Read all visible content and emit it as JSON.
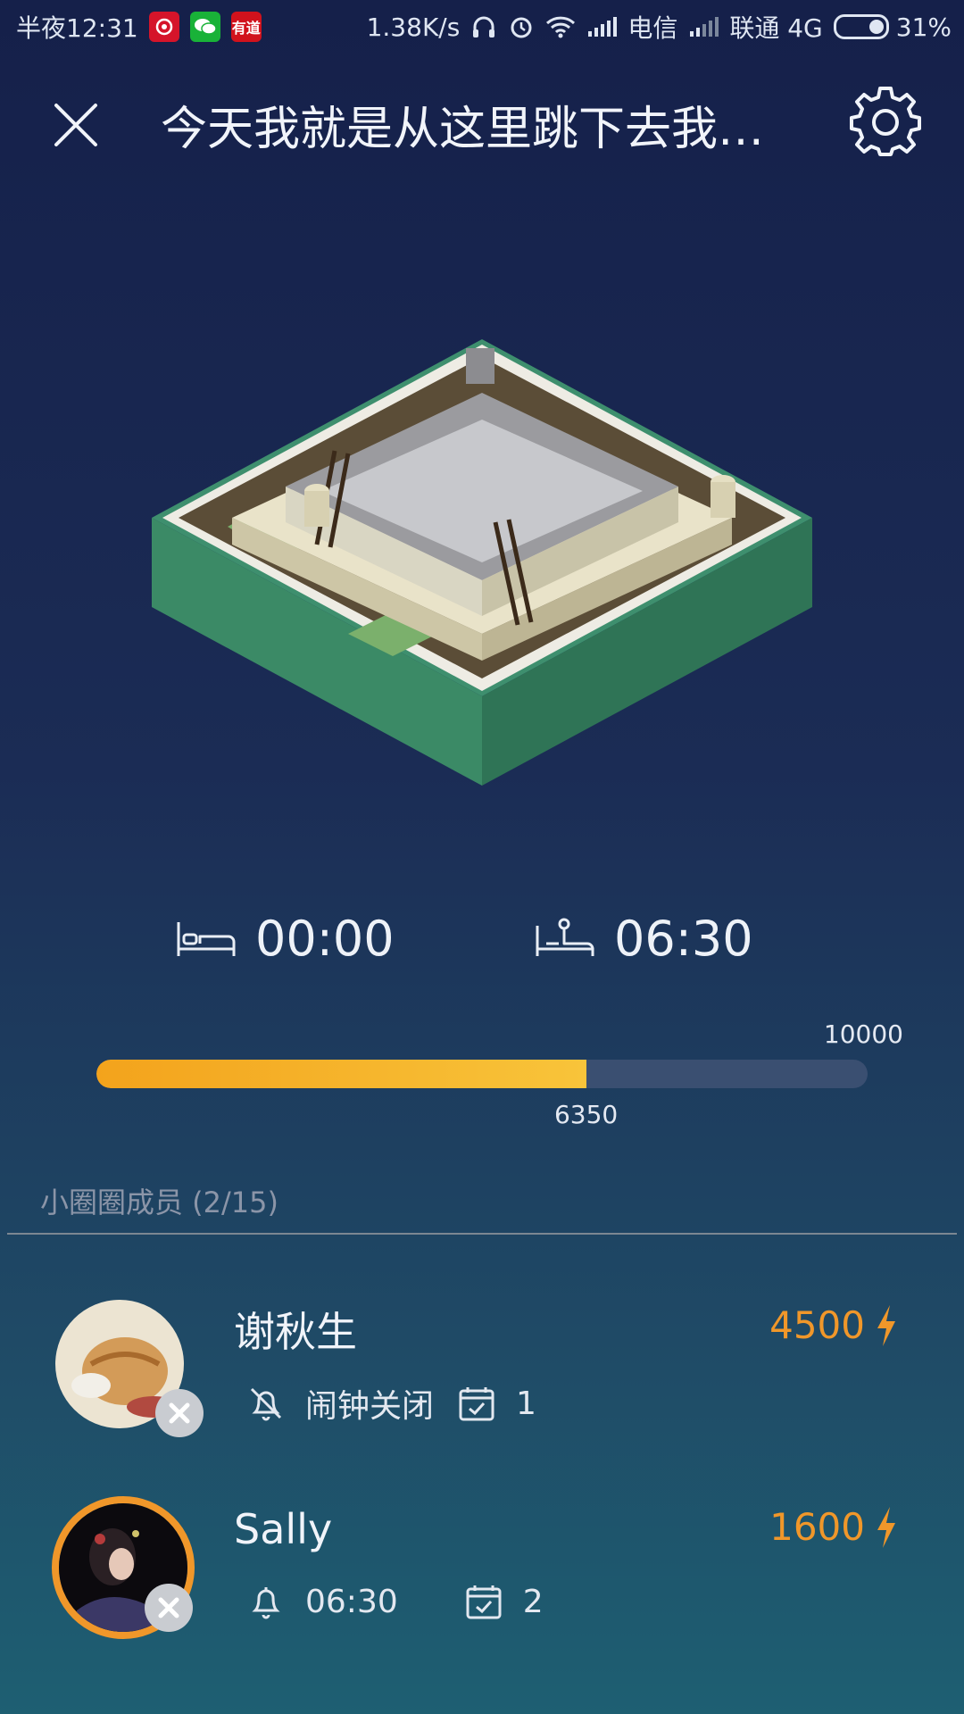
{
  "status_bar": {
    "time": "半夜12:31",
    "apps": [
      "netease-music",
      "wechat",
      "youdao"
    ],
    "youdao_label": "有道",
    "net_speed": "1.38K/s",
    "carrier1": "电信",
    "carrier2": "联通 4G",
    "battery": "31%"
  },
  "header": {
    "title": "今天我就是从这里跳下去我也…"
  },
  "alarm": {
    "sleep_time": "00:00",
    "wake_time": "06:30"
  },
  "progress": {
    "goal": "10000",
    "current": "6350",
    "fraction": 0.635
  },
  "members": {
    "heading": "小圈圈成员 (2/15)",
    "list": [
      {
        "name": "谢秋生",
        "score": "4500",
        "alarm": "闹钟关闭",
        "check_count": "1"
      },
      {
        "name": "Sally",
        "score": "1600",
        "alarm": "06:30",
        "check_count": "2"
      }
    ]
  },
  "colors": {
    "accent": "#f0972a",
    "progress_start": "#f3a31c",
    "progress_end": "#f8c43a",
    "track": "#3a4f71"
  }
}
